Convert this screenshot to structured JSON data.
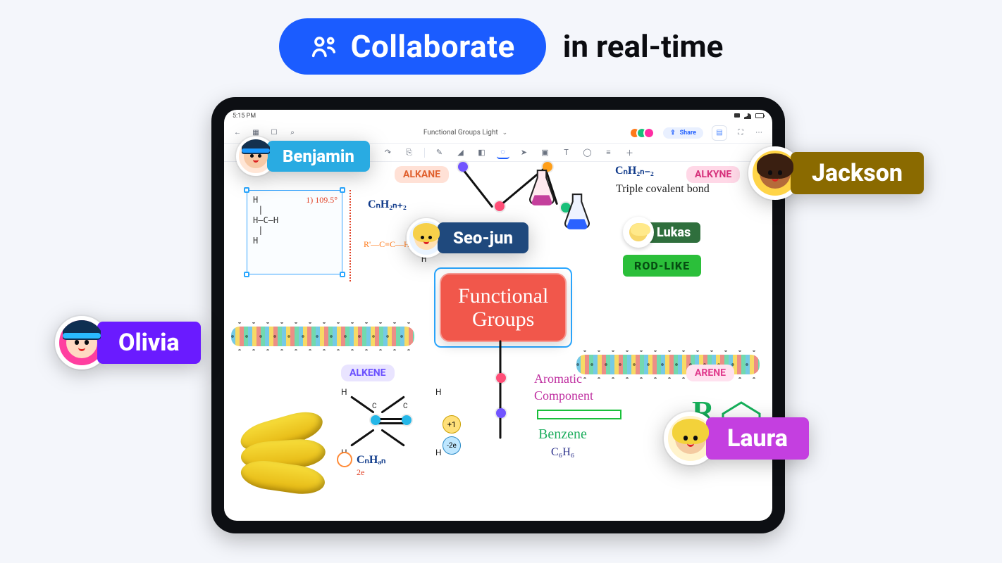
{
  "headline": {
    "pill": "Collaborate",
    "rest": "in real-time"
  },
  "status": {
    "time": "5:15 PM"
  },
  "topbar": {
    "title": "Functional Groups Light",
    "share": "Share"
  },
  "canvas": {
    "labels": {
      "alkane": "ALKANE",
      "alkene": "ALKENE",
      "arene": "ARENE",
      "alkyne": "ALKYNE"
    },
    "formulas": {
      "cnh2n2": "CₙH₂ₙ₊₂",
      "cnh2n2b": "CₙH₂ₙ₋₂",
      "rch": "R'—C≡C—H",
      "aromatic_title": "Aromatic",
      "aromatic_sub": "Component",
      "benzene": "Benzene",
      "cnh2n": "CₙH₂ₙ",
      "c6h6": "C₆H₆",
      "triple": "Triple covalent bond",
      "r_big": "R"
    },
    "center_title_line1": "Functional",
    "center_title_line2": "Groups",
    "lukas_chip": "Lukas",
    "rod_like": "ROD-LIKE",
    "mini_formula": "CₙHₐₙ",
    "mini_sub": "2e",
    "ions": {
      "plus": "+1",
      "minus": "-2e"
    },
    "box_scrawl": "1) 109.5°"
  },
  "tags": {
    "benjamin": "Benjamin",
    "seojun": "Seo-jun",
    "lukas": "Lukas",
    "olivia": "Olivia",
    "jackson": "Jackson",
    "laura": "Laura"
  },
  "colors": {
    "benjamin": "#29abe2",
    "seojun": "#1f497d",
    "lukas": "#2f6f3d",
    "olivia": "#6a1bff",
    "jackson": "#8a6a00",
    "laura": "#c43fe0"
  }
}
